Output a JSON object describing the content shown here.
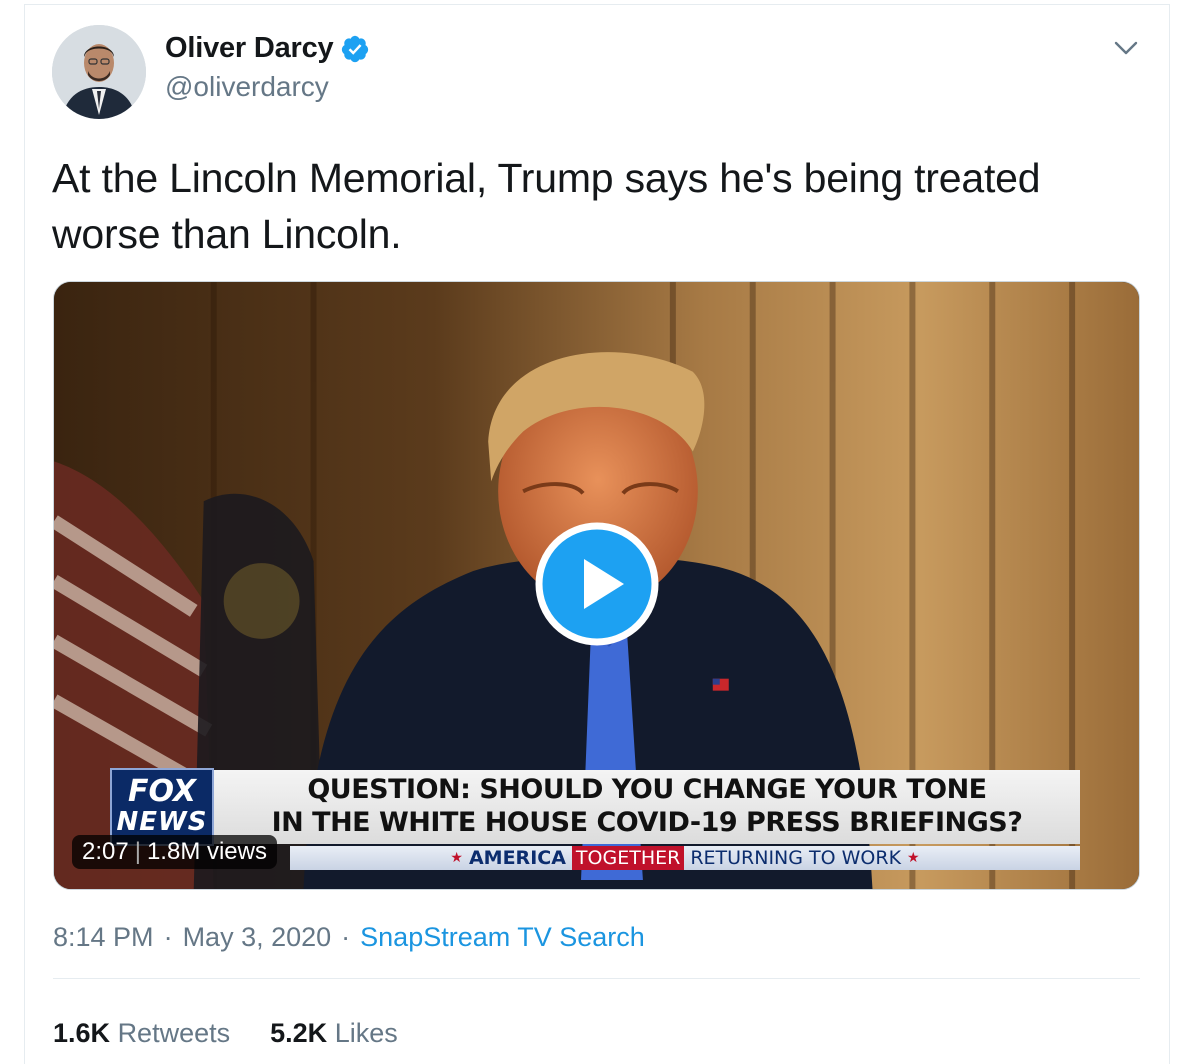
{
  "author": {
    "name": "Oliver Darcy",
    "handle": "@oliverdarcy",
    "verified": true
  },
  "tweet": {
    "text": "At the Lincoln Memorial, Trump says he's being treated worse than Lincoln."
  },
  "video": {
    "duration": "2:07",
    "views": "1.8M views",
    "chyron": {
      "logo_line1": "FOX",
      "logo_line2": "NEWS",
      "question_line1": "QUESTION: SHOULD YOU CHANGE YOUR TONE",
      "question_line2": "IN THE WHITE HOUSE COVID-19 PRESS BRIEFINGS?",
      "strip_america": "AMERICA",
      "strip_together": "TOGETHER",
      "strip_returning": "RETURNING TO WORK"
    }
  },
  "meta": {
    "time": "8:14 PM",
    "date": "May 3, 2020",
    "separator": "·",
    "source": "SnapStream TV Search"
  },
  "stats": {
    "retweets_count": "1.6K",
    "retweets_label": "Retweets",
    "likes_count": "5.2K",
    "likes_label": "Likes"
  },
  "colors": {
    "link": "#1b95e0",
    "verified": "#1da1f2",
    "muted": "#657786",
    "text": "#14171a"
  },
  "icons": [
    "verified-badge-icon",
    "chevron-down-icon",
    "play-icon"
  ]
}
